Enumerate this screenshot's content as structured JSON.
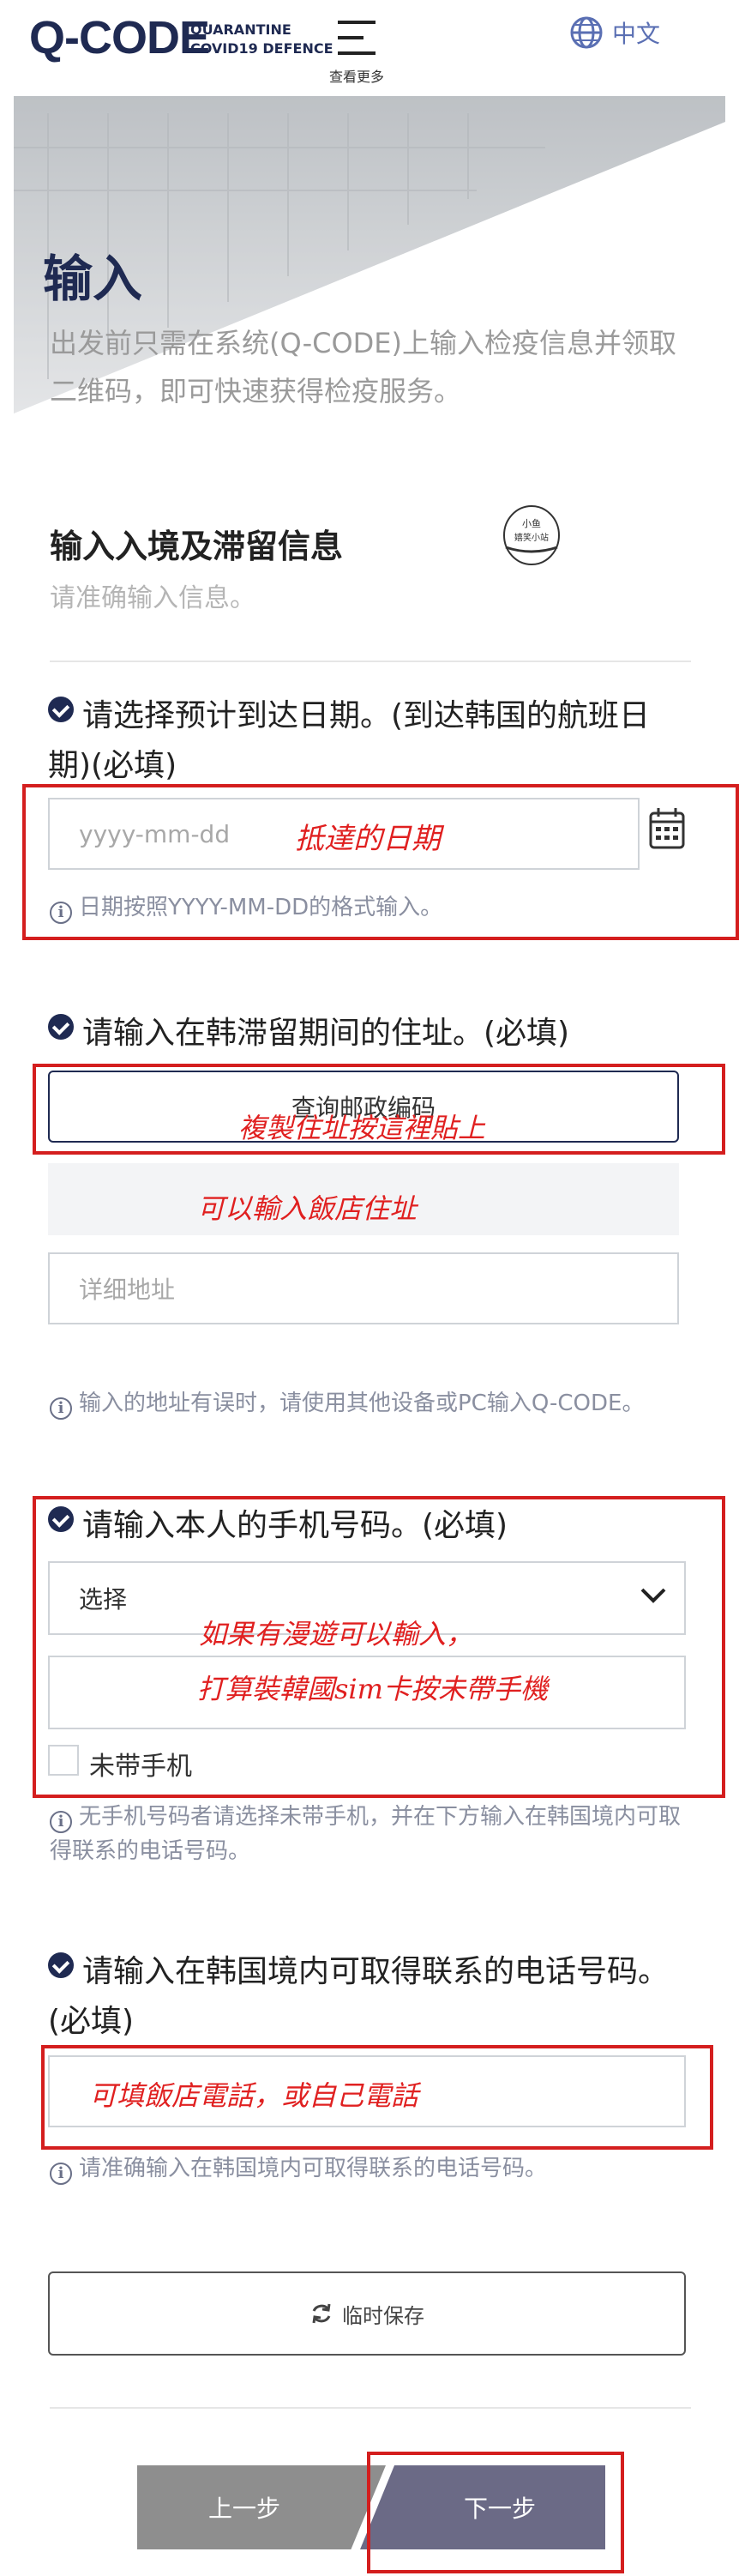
{
  "header": {
    "logo": "Q-CODE",
    "logo_sub_line1": "QUARANTINE",
    "logo_sub_line2": "COVID19 DEFENCE",
    "menu_label": "查看更多",
    "language": "中文"
  },
  "hero": {
    "title": "输入",
    "description": "出发前只需在系统(Q-CODE)上输入检疫信息并领取二维码，即可快速获得检疫服务。"
  },
  "section": {
    "title": "输入入境及滞留信息",
    "subtitle": "请准确输入信息。",
    "stamp_line1": "小鱼",
    "stamp_line2": "嬉笑小站"
  },
  "arrival": {
    "label": "请选择预计到达日期。(到达韩国的航班日期)(必填)",
    "placeholder": "yyyy-mm-dd",
    "hint": "日期按照YYYY-MM-DD的格式输入。",
    "annotation": "抵達的日期"
  },
  "address": {
    "label": "请输入在韩滞留期间的住址。(必填)",
    "search_button": "查询邮政编码",
    "annotation1": "複製住址按這裡貼上",
    "annotation2": "可以輸入飯店住址",
    "detail_placeholder": "详细地址",
    "hint": "输入的地址有误时，请使用其他设备或PC输入Q-CODE。"
  },
  "phone": {
    "label": "请输入本人的手机号码。(必填)",
    "select_value": "选择",
    "annotation1": "如果有漫遊可以輸入，",
    "annotation2": "打算裝韓國sim卡按未帶手機",
    "no_phone_label": "未带手机",
    "hint": "无手机号码者请选择未带手机，并在下方输入在韩国境内可取得联系的电话号码。"
  },
  "contact": {
    "label": "请输入在韩国境内可取得联系的电话号码。(必填)",
    "annotation": "可填飯店電話，或自己電話",
    "hint": "请准确输入在韩国境内可取得联系的电话号码。"
  },
  "actions": {
    "save_label": "临时保存",
    "prev_label": "上一步",
    "next_label": "下一步"
  }
}
